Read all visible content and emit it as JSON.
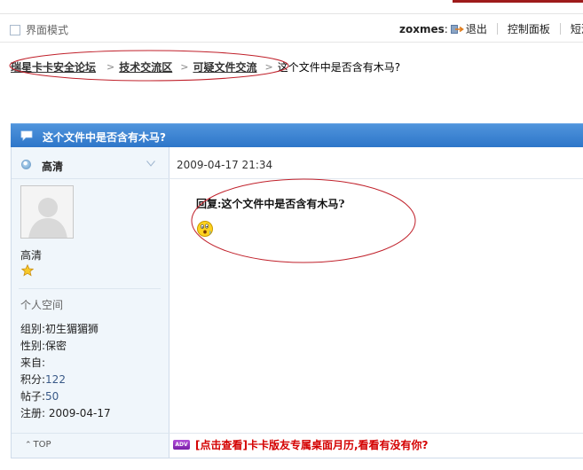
{
  "topbar": {
    "mode_label": "界面模式",
    "username": "zoxmes",
    "colon": ":",
    "logout_label": "退出",
    "control_panel_label": "控制面板",
    "sms_label": "短消"
  },
  "breadcrumb": {
    "items": [
      "瑞星卡卡安全论坛",
      "技术交流区",
      "可疑文件交流"
    ],
    "separator": ">",
    "current": "这个文件中是否含有木马?"
  },
  "thread": {
    "title": "这个文件中是否含有木马?"
  },
  "post": {
    "author": "高清",
    "timestamp": "2009-04-17 21:34",
    "reply_title": "回复:这个文件中是否含有木马?",
    "personal_space_label": "个人空间",
    "profile": [
      {
        "label": "组别:",
        "value": "初生猸猸狮"
      },
      {
        "label": "性别:",
        "value": "保密"
      },
      {
        "label": "来自:",
        "value": ""
      },
      {
        "label": "积分:",
        "value": "122"
      },
      {
        "label": "帖子:",
        "value": "50"
      },
      {
        "label": "注册:",
        "value": " 2009-04-17"
      }
    ],
    "top_link": "TOP",
    "ad_badge": "ADV",
    "ad_text": "[点击查看]卡卡版友专属桌面月历,看看有没有你?"
  },
  "colors": {
    "header_blue": "#2e76c9",
    "sidebar_bg": "#f0f6fb",
    "annotation_red": "#c0202a",
    "ad_red": "#d40000"
  },
  "icons": {
    "logout": "logout-icon",
    "thread": "speech-bubble-icon",
    "online": "online-status-icon",
    "menu": "chevron-down-icon",
    "rank": "star-icon",
    "emoji": "surprised-face-icon"
  }
}
